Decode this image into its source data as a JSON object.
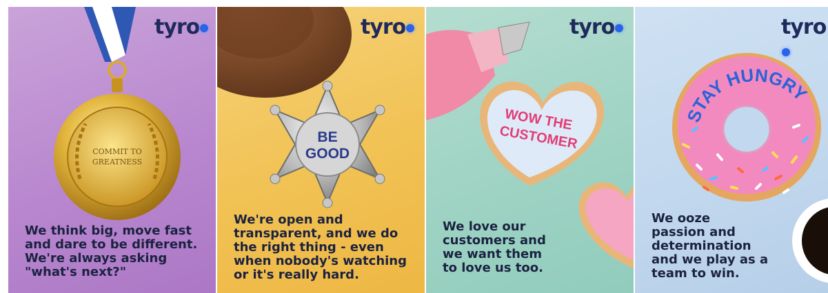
{
  "brand": {
    "logo_text": "tyro",
    "text_color": "#1f2a5c",
    "dot_color": "#2a63e8"
  },
  "panels": [
    {
      "id": "medal",
      "background": "#b987cf",
      "medal_text": "COMMIT TO\nGREATNESS",
      "caption": "We think big, move fast\nand dare to be different.\nWe're always asking\n\"what's next?\""
    },
    {
      "id": "badge",
      "background": "#f1c254",
      "badge_text_line1": "BE",
      "badge_text_line2": "GOOD",
      "caption": "We're open and\ntransparent, and we do\nthe right thing - even\nwhen nobody's watching\nor it's really hard."
    },
    {
      "id": "cookie",
      "background": "#9fd3c4",
      "cookie_text_line1": "WOW THE",
      "cookie_text_line2": "CUSTOMER",
      "caption": "We love our\ncustomers and\nwe want them\nto love us too."
    },
    {
      "id": "donut",
      "background": "#c2d8ee",
      "donut_text": "STAY HUNGRY",
      "caption": "We ooze\npassion and\ndetermination\nand we play as a\nteam to win."
    }
  ]
}
